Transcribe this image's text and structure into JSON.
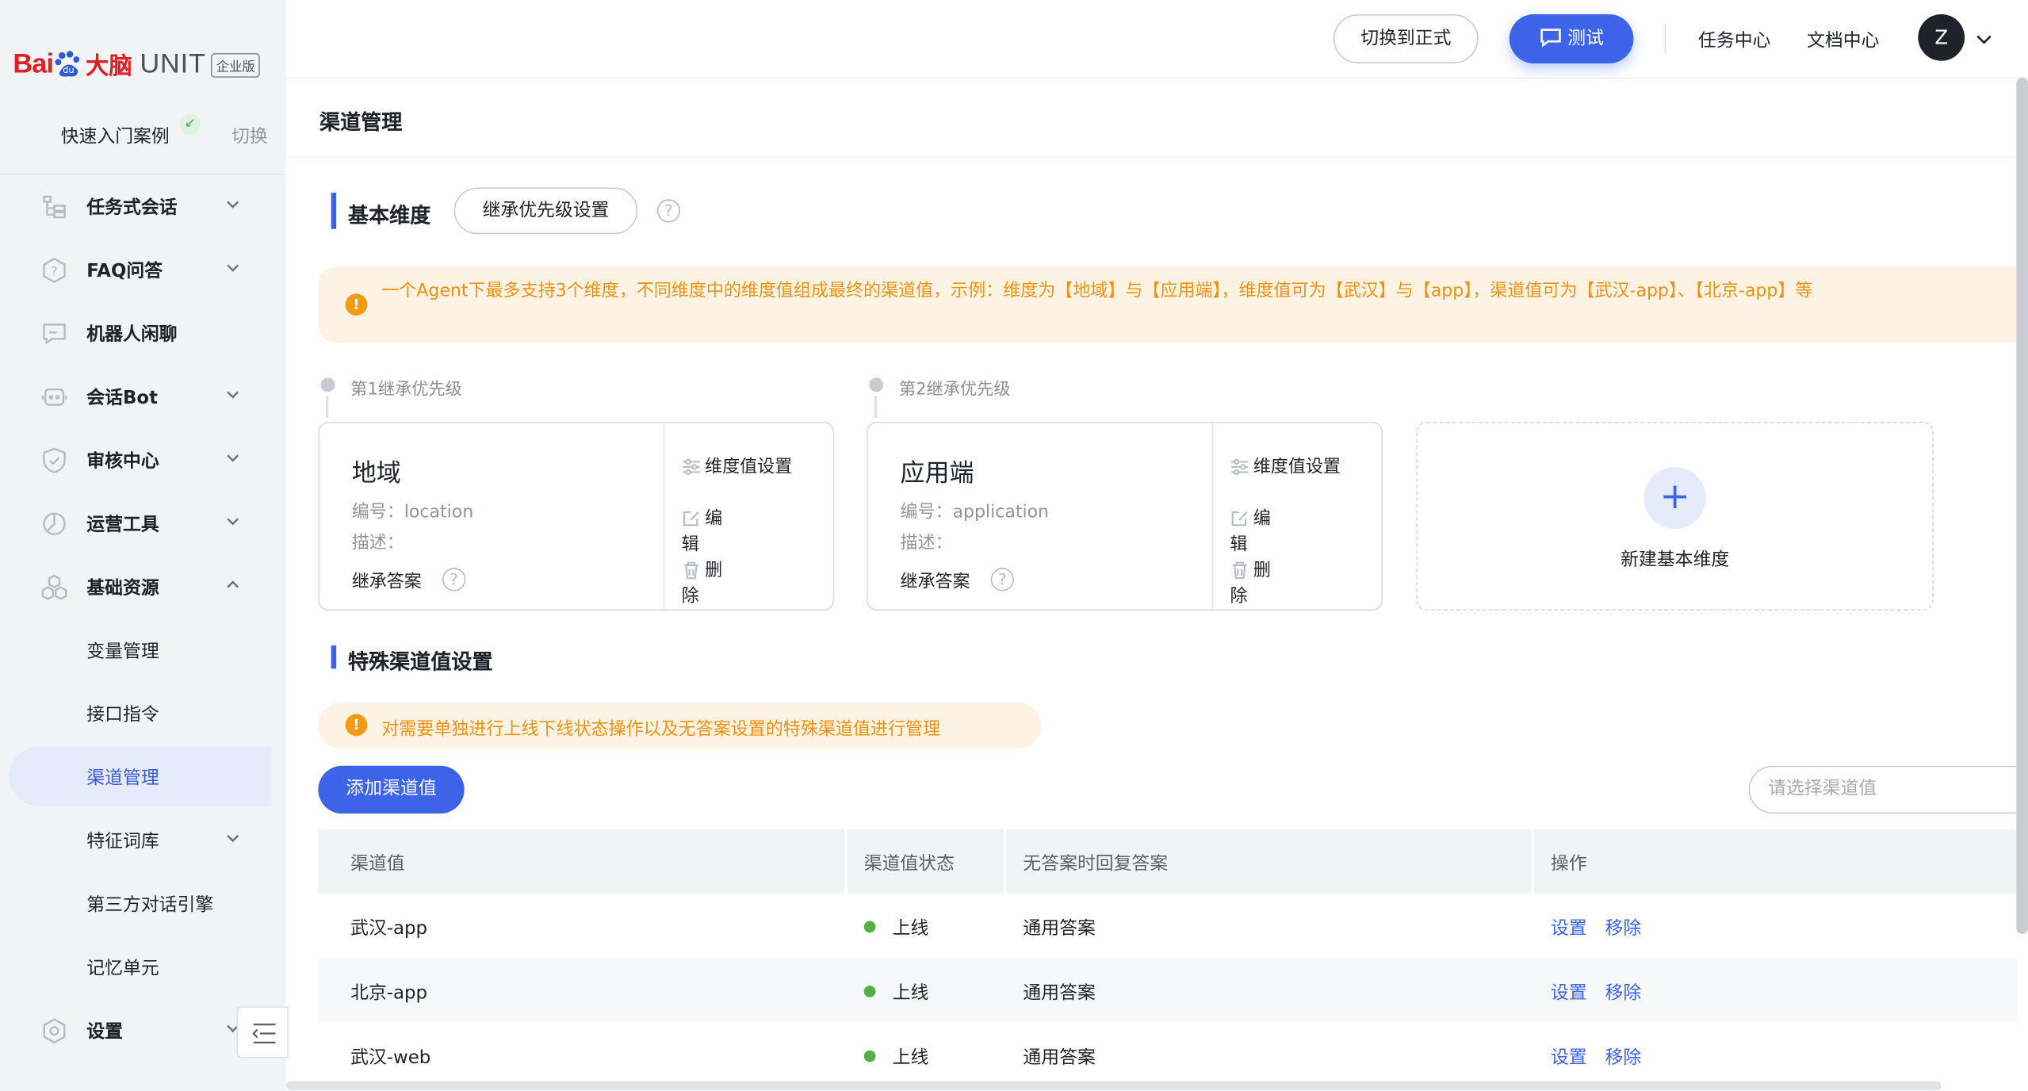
{
  "brand": {
    "bai": "Bai",
    "du": "du",
    "danao": "大脑",
    "unit": "UNIT",
    "edition": "企业版"
  },
  "agent": {
    "name": "快速入门案例",
    "switch_label": "切换"
  },
  "sidebar": {
    "items": [
      {
        "label": "任务式会话",
        "icon": "task-dialog-icon",
        "expandable": true
      },
      {
        "label": "FAQ问答",
        "icon": "faq-icon",
        "expandable": true
      },
      {
        "label": "机器人闲聊",
        "icon": "chat-icon",
        "expandable": false
      },
      {
        "label": "会话Bot",
        "icon": "bot-icon",
        "expandable": true
      },
      {
        "label": "审核中心",
        "icon": "shield-icon",
        "expandable": true
      },
      {
        "label": "运营工具",
        "icon": "ops-tools-icon",
        "expandable": true
      },
      {
        "label": "基础资源",
        "icon": "resources-icon",
        "expandable": true,
        "expanded": true
      },
      {
        "label": "变量管理",
        "sub": true
      },
      {
        "label": "接口指令",
        "sub": true
      },
      {
        "label": "渠道管理",
        "sub": true,
        "active": true
      },
      {
        "label": "特征词库",
        "sub": true,
        "expandable": true
      },
      {
        "label": "第三方对话引擎",
        "sub": true
      },
      {
        "label": "记忆单元",
        "sub": true
      },
      {
        "label": "设置",
        "icon": "settings-icon",
        "expandable": true
      }
    ]
  },
  "header": {
    "switch_formal": "切换到正式",
    "test": "测试",
    "task_center": "任务中心",
    "doc_center": "文档中心",
    "avatar_letter": "Z"
  },
  "page": {
    "title": "渠道管理"
  },
  "basic": {
    "title": "基本维度",
    "inherit_button": "继承优先级设置",
    "warning": "一个Agent下最多支持3个维度，不同维度中的维度值组成最终的渠道值，示例：维度为【地域】与【应用端】，维度值可为【武汉】与【app】，渠道值可为【武汉-app】、【北京-app】等",
    "priorities": [
      "第1继承优先级",
      "第2继承优先级"
    ],
    "cards": [
      {
        "name": "地域",
        "id": "编号：location",
        "desc": "描述：",
        "inherit": "继承答案",
        "act_setting": "维度值设置",
        "act_edit": "编辑",
        "act_delete": "删除"
      },
      {
        "name": "应用端",
        "id": "编号：application",
        "desc": "描述：",
        "inherit": "继承答案",
        "act_setting": "维度值设置",
        "act_edit": "编辑",
        "act_delete": "删除"
      }
    ],
    "new_dimension": "新建基本维度"
  },
  "special": {
    "title": "特殊渠道值设置",
    "warning": "对需要单独进行上线下线状态操作以及无答案设置的特殊渠道值进行管理",
    "add_button": "添加渠道值",
    "select_placeholder": "请选择渠道值",
    "columns": [
      "渠道值",
      "渠道值状态",
      "无答案时回复答案",
      "操作"
    ],
    "rows": [
      {
        "channel": "武汉-app",
        "status": "上线",
        "answer": "通用答案",
        "op_set": "设置",
        "op_remove": "移除"
      },
      {
        "channel": "北京-app",
        "status": "上线",
        "answer": "通用答案",
        "op_set": "设置",
        "op_remove": "移除"
      },
      {
        "channel": "武汉-web",
        "status": "上线",
        "answer": "通用答案",
        "op_set": "设置",
        "op_remove": "移除"
      }
    ]
  },
  "colors": {
    "accent": "#3d64e8",
    "warning": "#f0920f",
    "online": "#52b043"
  }
}
